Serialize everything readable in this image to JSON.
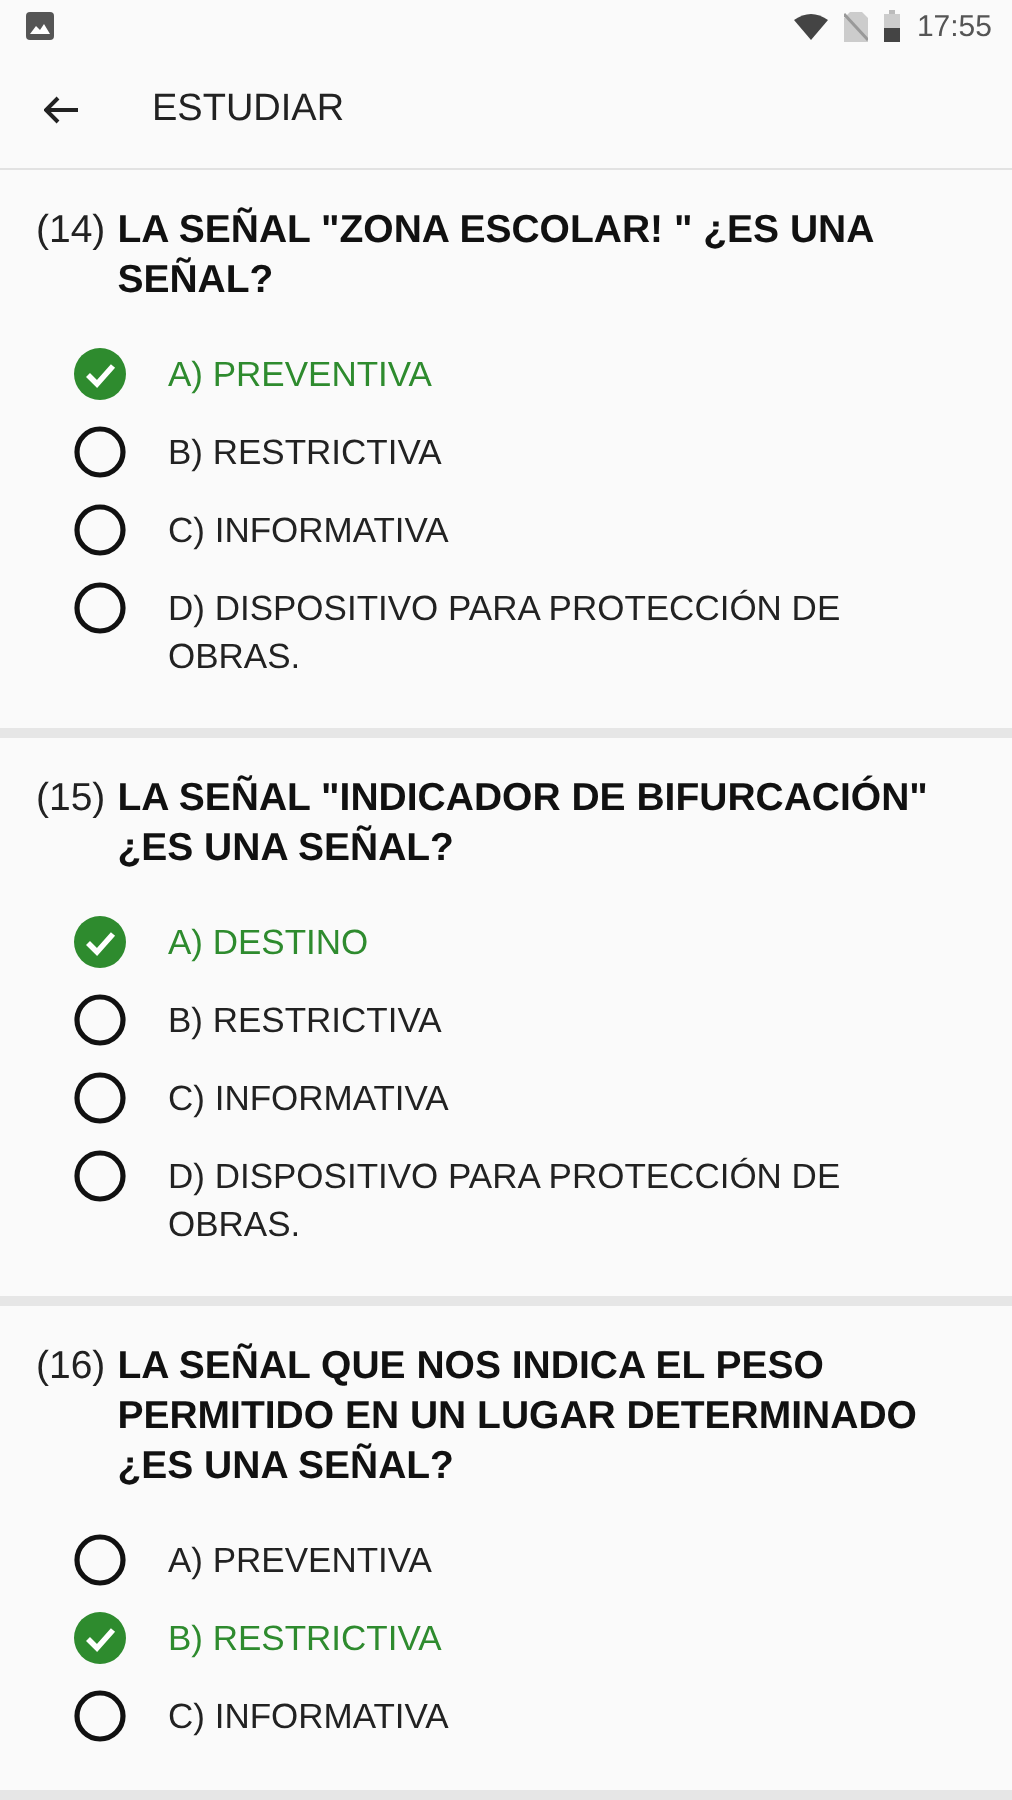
{
  "status_bar": {
    "time": "17:55"
  },
  "app_bar": {
    "title": "ESTUDIAR"
  },
  "questions": [
    {
      "number": "(14)",
      "text": "LA SEÑAL \"ZONA ESCOLAR! \" ¿ES UNA SEÑAL?",
      "options": [
        {
          "label": "A) PREVENTIVA",
          "selected": true
        },
        {
          "label": "B) RESTRICTIVA",
          "selected": false
        },
        {
          "label": "C) INFORMATIVA",
          "selected": false
        },
        {
          "label": "D) DISPOSITIVO PARA PROTECCIÓN DE OBRAS.",
          "selected": false
        }
      ]
    },
    {
      "number": "(15)",
      "text": "LA SEÑAL \"INDICADOR DE BIFURCACIÓN\" ¿ES UNA SEÑAL?",
      "options": [
        {
          "label": "A) DESTINO",
          "selected": true
        },
        {
          "label": "B) RESTRICTIVA",
          "selected": false
        },
        {
          "label": "C) INFORMATIVA",
          "selected": false
        },
        {
          "label": "D) DISPOSITIVO PARA PROTECCIÓN DE OBRAS.",
          "selected": false
        }
      ]
    },
    {
      "number": "(16)",
      "text": "LA SEÑAL QUE NOS INDICA EL PESO PERMITIDO EN UN LUGAR DETERMINADO ¿ES UNA SEÑAL?",
      "options": [
        {
          "label": "A) PREVENTIVA",
          "selected": false
        },
        {
          "label": "B) RESTRICTIVA",
          "selected": true
        },
        {
          "label": "C) INFORMATIVA",
          "selected": false
        }
      ]
    }
  ]
}
